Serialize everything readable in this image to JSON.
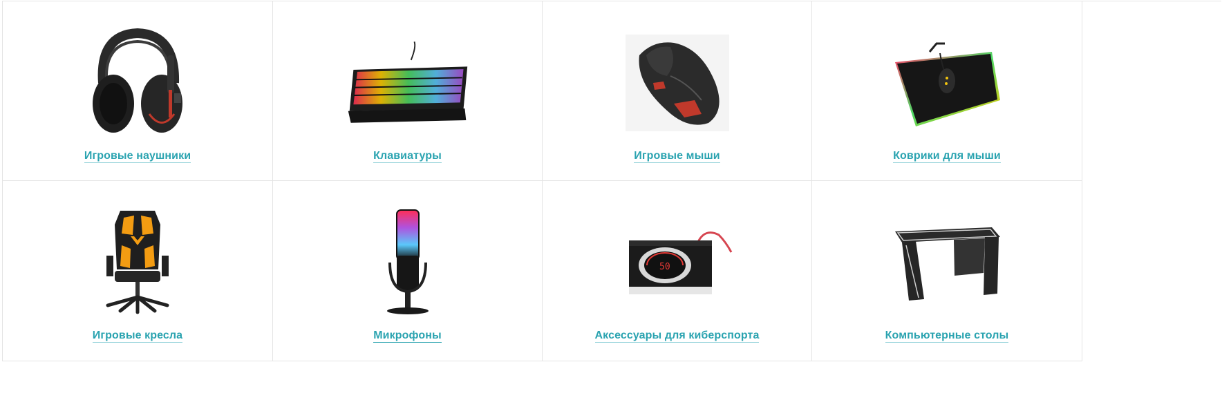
{
  "categories": [
    {
      "label": "Игровые наушники",
      "icon": "headphones-icon"
    },
    {
      "label": "Клавиатуры",
      "icon": "keyboard-icon"
    },
    {
      "label": "Игровые мыши",
      "icon": "mouse-icon"
    },
    {
      "label": "Коврики для мыши",
      "icon": "mousepad-icon"
    },
    {
      "label": "Игровые кресла",
      "icon": "gaming-chair-icon"
    },
    {
      "label": "Микрофоны",
      "icon": "microphone-icon"
    },
    {
      "label": "Аксессуары для киберспорта",
      "icon": "sound-card-icon"
    },
    {
      "label": "Компьютерные столы",
      "icon": "desk-icon"
    }
  ],
  "colors": {
    "link": "#2aa3b0",
    "border": "#e4e4e4"
  }
}
